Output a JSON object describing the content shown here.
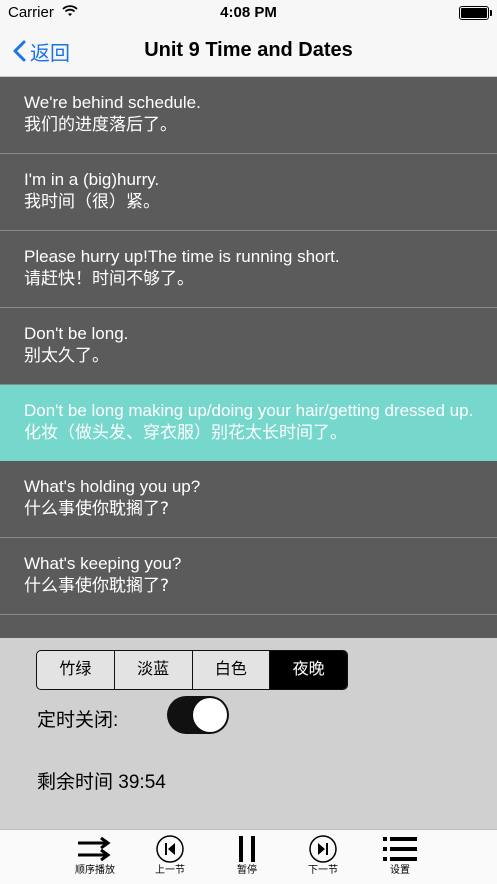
{
  "status_bar": {
    "carrier": "Carrier",
    "time": "4:08 PM"
  },
  "nav": {
    "back_label": "返回",
    "title": "Unit 9 Time and Dates"
  },
  "sentences": [
    {
      "en": "We're behind schedule.",
      "zh": "我们的进度落后了。"
    },
    {
      "en": "I'm in a (big)hurry.",
      "zh": "我时间（很）紧。"
    },
    {
      "en": "Please hurry up!The time is running short.",
      "zh": "请赶快！时间不够了。"
    },
    {
      "en": "Don't be long.",
      "zh": "别太久了。"
    },
    {
      "en": "Don't be long making up/doing your hair/getting dressed up.",
      "zh": "化妆（做头发、穿衣服）别花太长时间了。"
    },
    {
      "en": "What's holding you up?",
      "zh": "什么事使你耽搁了?"
    },
    {
      "en": "What's keeping you?",
      "zh": "什么事使你耽搁了?"
    }
  ],
  "active_sentence_index": 4,
  "settings": {
    "themes": [
      "竹绿",
      "淡蓝",
      "白色",
      "夜晚"
    ],
    "selected_theme": "夜晚",
    "timer_label": "定时关闭:",
    "timer_enabled": true,
    "remaining_text": "剩余时间 39:54"
  },
  "tab_bar": {
    "items": [
      {
        "label": "顺序播放",
        "icon": "sequential-play-icon"
      },
      {
        "label": "上一节",
        "icon": "previous-icon"
      },
      {
        "label": "暂停",
        "icon": "pause-icon"
      },
      {
        "label": "下一节",
        "icon": "next-icon"
      },
      {
        "label": "设置",
        "icon": "menu-icon"
      }
    ]
  },
  "colors": {
    "list_background": "#5b5b5b",
    "active_row": "#76d8cc",
    "accent": "#1a73e8",
    "selected_segment": "#000000"
  }
}
